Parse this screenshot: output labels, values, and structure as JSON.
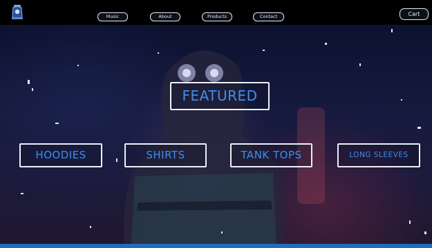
{
  "nav": {
    "items": [
      {
        "label": "Music"
      },
      {
        "label": "About"
      },
      {
        "label": "Products"
      },
      {
        "label": "Contact"
      }
    ],
    "cart_label": "Cart",
    "logo_icon": "lantern-logo-icon"
  },
  "hero": {
    "featured_label": "FEATURED",
    "categories": [
      {
        "label": "HOODIES"
      },
      {
        "label": "SHIRTS"
      },
      {
        "label": "TANK TOPS"
      },
      {
        "label": "LONG SLEEVES"
      }
    ]
  },
  "colors": {
    "accent_text": "#3f8df0",
    "border": "#eef2f8",
    "bottom_strip": "#1f6dbf",
    "background": "#000000"
  }
}
